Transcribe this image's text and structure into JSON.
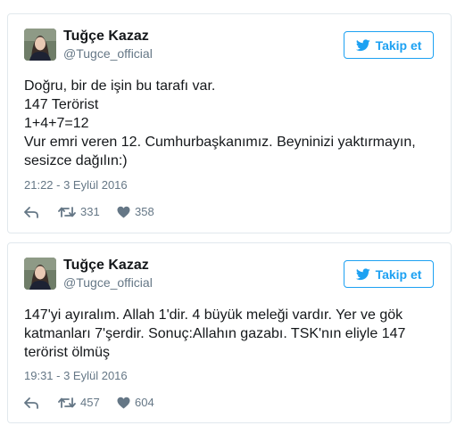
{
  "colors": {
    "accent": "#1da1f2",
    "text": "#14171a",
    "muted": "#657786",
    "border": "#e1e8ed"
  },
  "tweets": [
    {
      "author_name": "Tuğçe Kazaz",
      "author_handle": "@Tugce_official",
      "follow_label": "Takip et",
      "follow_icon": "twitter-bird-icon",
      "lines": [
        "Doğru, bir de işin bu tarafı var.",
        "147 Terörist",
        "1+4+7=12",
        "Vur emri veren 12. Cumhurbaşkanımız. Beyninizi yaktırmayın,",
        "sesizce dağılın:)"
      ],
      "timestamp": "21:22 - 3 Eylül 2016",
      "retweets": "331",
      "likes": "358",
      "icons": [
        "reply-icon",
        "retweet-icon",
        "heart-icon"
      ]
    },
    {
      "author_name": "Tuğçe Kazaz",
      "author_handle": "@Tugce_official",
      "follow_label": "Takip et",
      "follow_icon": "twitter-bird-icon",
      "lines": [
        "147'yi ayıralım. Allah 1'dir. 4 büyük meleği vardır. Yer ve gök",
        "katmanları 7'şerdir. Sonuç:Allahın gazabı. TSK'nın eliyle 147",
        "terörist ölmüş"
      ],
      "timestamp": "19:31 - 3 Eylül 2016",
      "retweets": "457",
      "likes": "604",
      "icons": [
        "reply-icon",
        "retweet-icon",
        "heart-icon"
      ]
    }
  ]
}
